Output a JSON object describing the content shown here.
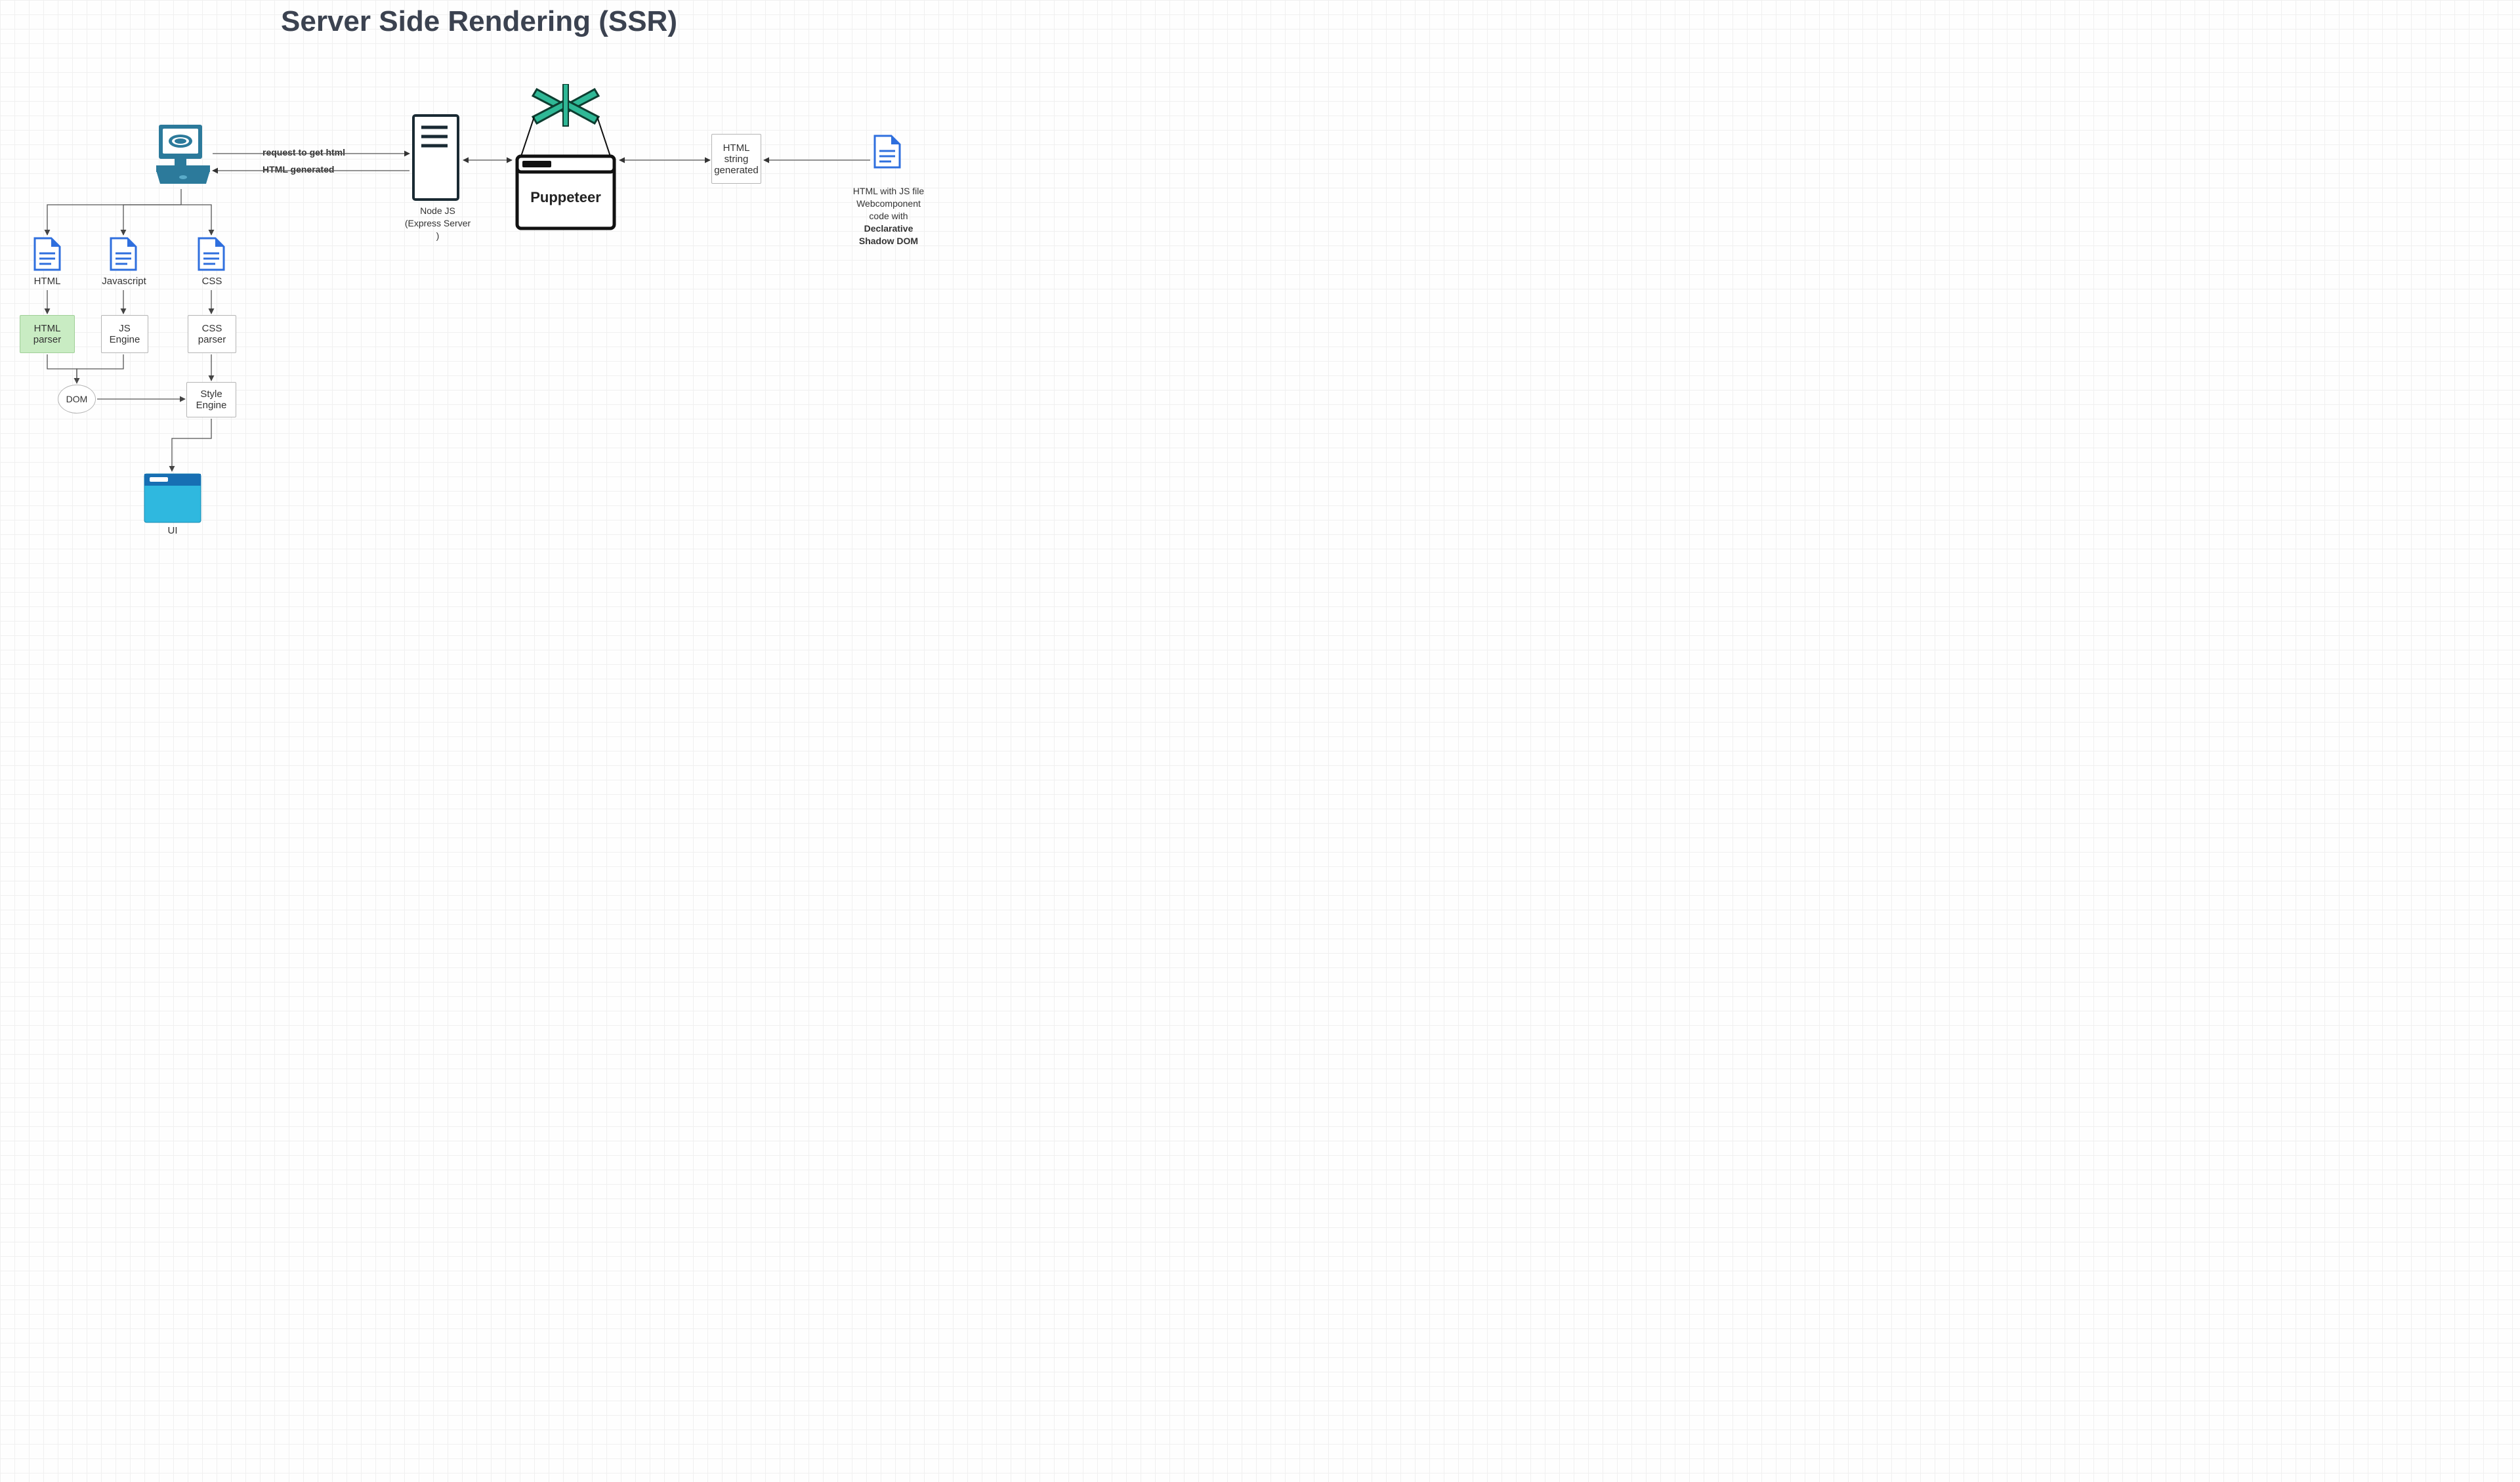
{
  "title": "Server Side Rendering (SSR)",
  "edges": {
    "request": "request to get html",
    "response": "HTML generated",
    "html_string": "HTML\nstring\ngenerated"
  },
  "nodes": {
    "nodejs": "Node JS (Express Server )",
    "puppeteer": "Puppeteer",
    "source_file": "HTML with JS file Webcomponent code  with",
    "source_file_bold": "Declarative Shadow DOM"
  },
  "client": {
    "html": "HTML",
    "js": "Javascript",
    "css": "CSS",
    "html_parser": "HTML parser",
    "js_engine": "JS Engine",
    "css_parser": "CSS parser",
    "dom": "DOM",
    "style_engine": "Style Engine",
    "ui": "UI"
  }
}
